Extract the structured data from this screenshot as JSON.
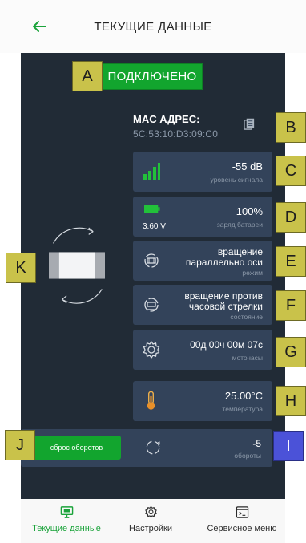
{
  "header": {
    "title": "ТЕКУЩИЕ ДАННЫЕ",
    "back_icon": "arrow-left-icon"
  },
  "markers": {
    "A": "A",
    "B": "B",
    "C": "C",
    "D": "D",
    "E": "E",
    "F": "F",
    "G": "G",
    "H": "H",
    "I": "I",
    "J": "J",
    "K": "K"
  },
  "connection": {
    "status": "ПОДКЛЮЧЕНО",
    "color": "#12a52e"
  },
  "mac": {
    "label": "MAC АДРЕС:",
    "value": "5C:53:10:D3:09:C0",
    "copy_icon": "copy-icon"
  },
  "signal": {
    "value": "-55 dB",
    "label": "уровень сигнала",
    "icon": "signal-bars-icon"
  },
  "battery": {
    "percent": "100%",
    "label": "заряд батареи",
    "voltage": "3.60 V",
    "icon": "battery-icon",
    "level": 1.0
  },
  "rotation_mode": {
    "value_line1": "вращение",
    "value_line2": "параллельно оси",
    "label": "режим",
    "icon": "rotation-axis-icon"
  },
  "rotation_state": {
    "value_line1": "вращение против",
    "value_line2": "часовой стрелки",
    "label": "состояние",
    "icon": "rotation-state-icon"
  },
  "motor_hours": {
    "value": "00д 00ч 00м 07с",
    "label": "моточасы",
    "icon": "gear-icon"
  },
  "temperature": {
    "value": "25.00°С",
    "label": "температура",
    "icon": "thermometer-icon"
  },
  "turns": {
    "value": "-5",
    "label": "обороты",
    "icon": "refresh-icon"
  },
  "reset_button": {
    "label": "сброс оборотов"
  },
  "device": {
    "icon": "rotating-device-icon"
  },
  "nav": {
    "items": [
      {
        "label": "Текущие данные",
        "icon": "monitor-icon",
        "active": true
      },
      {
        "label": "Настройки",
        "icon": "settings-icon",
        "active": false
      },
      {
        "label": "Сервисное меню",
        "icon": "terminal-icon",
        "active": false
      }
    ]
  },
  "colors": {
    "accent": "#1aa33a",
    "panel": "#33435a",
    "background": "#212b36",
    "marker": "#c9c24a",
    "marker_blue": "#4b52d8"
  }
}
